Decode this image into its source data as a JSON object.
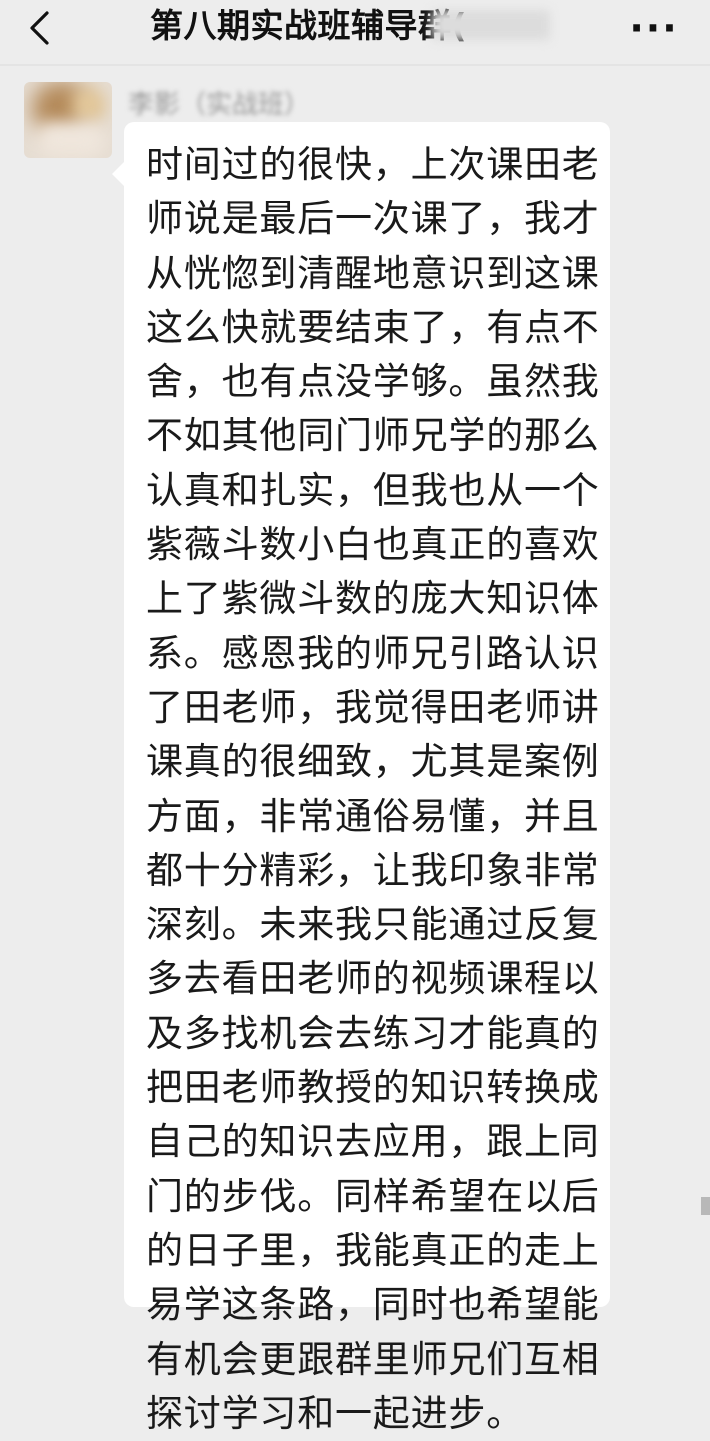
{
  "header": {
    "back_icon": "chevron-left-icon",
    "title": "第八期实战班辅导群(",
    "more_icon": "more-dots-icon",
    "more_label": "···"
  },
  "message": {
    "sender": "李影（实战班）",
    "avatar_icon": "avatar-image",
    "lines": [
      "时间过的很快，上次课田老",
      "师说是最后一次课了，我才",
      "从恍惚到清醒地意识到这课",
      "这么快就要结束了，有点不",
      "舍，也有点没学够。虽然我",
      "不如其他同门师兄学的那么",
      "认真和扎实，但我也从一个",
      "紫薇斗数小白也真正的喜欢",
      "上了紫微斗数的庞大知识体",
      "系。感恩我的师兄引路认识",
      "了田老师，我觉得田老师讲",
      "课真的很细致，尤其是案例",
      "方面，非常通俗易懂，并且",
      "都十分精彩，让我印象非常",
      "深刻。未来我只能通过反复",
      "多去看田老师的视频课程以",
      "及多找机会去练习才能真的",
      "把田老师教授的知识转换成",
      "自己的知识去应用，跟上同",
      "门的步伐。同样希望在以后",
      "的日子里，我能真正的走上",
      "易学这条路，同时也希望能",
      "有机会更跟群里师兄们互相",
      "探讨学习和一起进步。"
    ]
  },
  "colors": {
    "background": "#ededed",
    "bubble": "#ffffff",
    "text": "#1a1a1a"
  }
}
